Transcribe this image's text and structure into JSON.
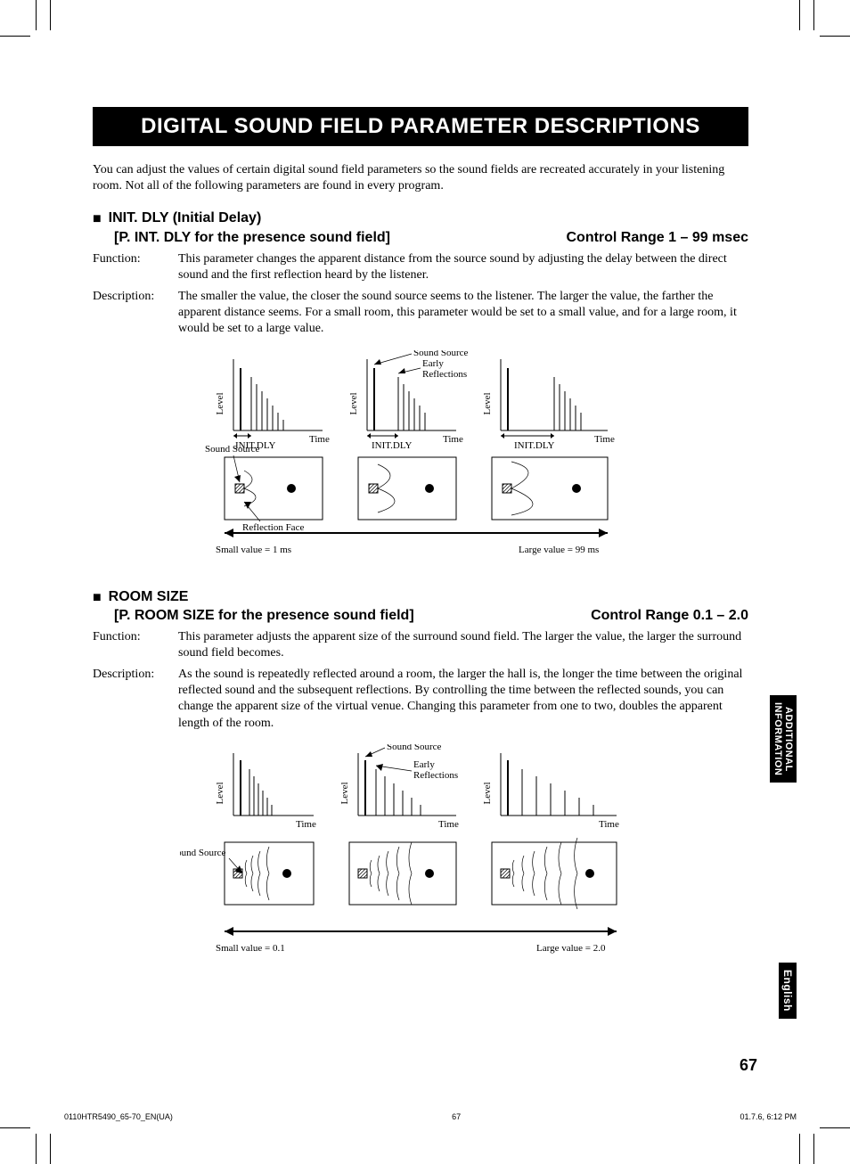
{
  "title": "DIGITAL SOUND FIELD PARAMETER DESCRIPTIONS",
  "intro": "You can adjust the values of certain digital sound field parameters so the sound fields are recreated accurately in your listening room. Not all of the following parameters are found in every program.",
  "section1": {
    "name": "INIT. DLY (Initial Delay)",
    "subname": "[P. INT. DLY for the presence sound field]",
    "range": "Control Range 1 – 99 msec",
    "function_label": "Function:",
    "function": "This parameter changes the apparent distance from the source sound by adjusting the delay between the direct sound and the first reflection heard by the listener.",
    "description_label": "Description:",
    "description": "The smaller the value, the closer the sound source seems to the listener. The larger the value, the farther the apparent distance seems. For a small room, this parameter would be set to a small value, and for a large room, it would be set to a large value.",
    "diagram": {
      "level": "Level",
      "time": "Time",
      "init_dly": "INIT.DLY",
      "sound_source": "Sound Source",
      "early_reflections": "Early Reflections",
      "reflection_face": "Reflection Face",
      "small": "Small value = 1 ms",
      "large": "Large value = 99 ms"
    }
  },
  "section2": {
    "name": "ROOM SIZE",
    "subname": "[P. ROOM SIZE for the presence sound field]",
    "range": "Control Range 0.1 – 2.0",
    "function_label": "Function:",
    "function": "This parameter adjusts the apparent size of the surround sound field. The larger the value, the larger the surround sound field becomes.",
    "description_label": "Description:",
    "description": "As the sound is repeatedly reflected around a room, the larger the hall is, the longer the time between the original reflected sound and the subsequent reflections. By controlling the time between the reflected sounds, you can change the apparent size of the virtual venue. Changing this parameter from one to two, doubles the apparent length of the room.",
    "diagram": {
      "level": "Level",
      "time": "Time",
      "sound_source": "Sound Source",
      "early_reflections": "Early Reflections",
      "small": "Small value = 0.1",
      "large": "Large value = 2.0"
    }
  },
  "side_tab1_a": "ADDITIONAL",
  "side_tab1_b": "INFORMATION",
  "side_tab2": "English",
  "page_number": "67",
  "footer": {
    "left": "0110HTR5490_65-70_EN(UA)",
    "center": "67",
    "right": "01.7.6, 6:12 PM"
  }
}
